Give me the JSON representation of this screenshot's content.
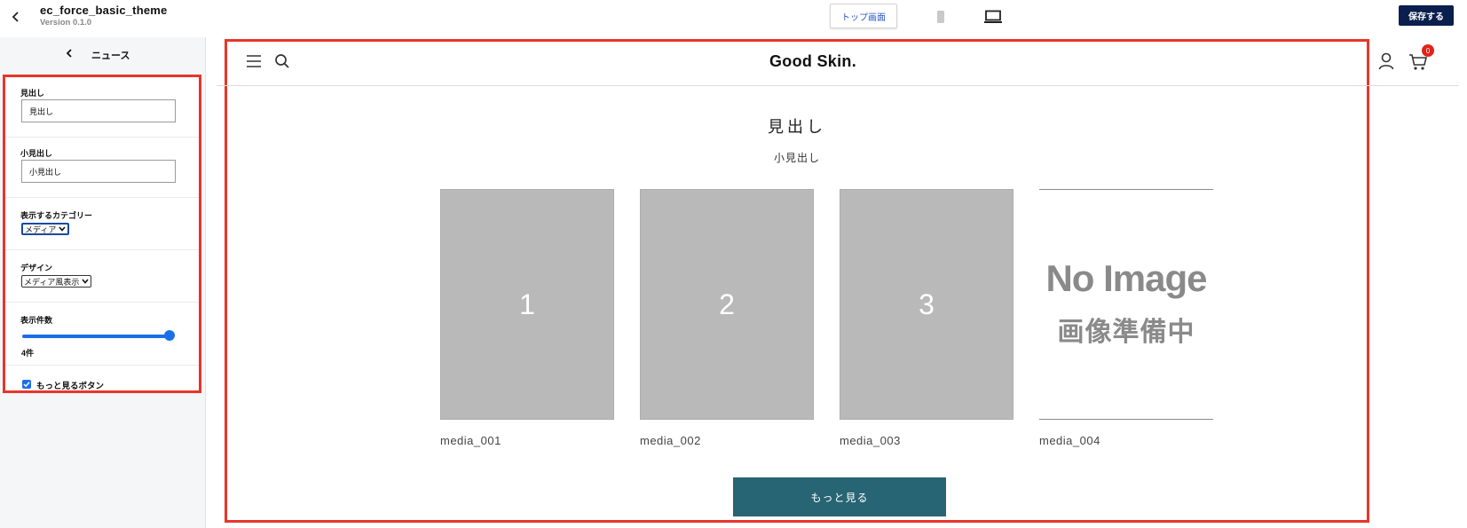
{
  "topbar": {
    "theme_name": "ec_force_basic_theme",
    "version": "Version 0.1.0",
    "top_page_label": "トップ画面",
    "save_label": "保存する"
  },
  "sidebar": {
    "title": "ニュース",
    "heading_label": "見出し",
    "heading_value": "見出し",
    "subheading_label": "小見出し",
    "subheading_value": "小見出し",
    "category_label": "表示するカテゴリー",
    "category_selected": "メディア",
    "design_label": "デザイン",
    "design_selected": "メディア風表示",
    "count_label": "表示件数",
    "count_value": "4件",
    "count_fraction": 1.0,
    "more_button_label": "もっと見るボタン",
    "more_button_checked": true
  },
  "preview": {
    "logo": "Good Skin.",
    "cart_count": "0",
    "heading": "見出し",
    "subheading": "小見出し",
    "cards": [
      {
        "image_label": "1",
        "name": "media_001"
      },
      {
        "image_label": "2",
        "name": "media_002"
      },
      {
        "image_label": "3",
        "name": "media_003"
      },
      {
        "image_label": "",
        "name": "media_004",
        "no_image_en": "No Image",
        "no_image_ja": "画像準備中"
      }
    ],
    "more_label": "もっと見る"
  },
  "colors": {
    "accent_blue": "#1a6fe8",
    "save_button": "#0a1f4e",
    "highlight_red": "#e8352a",
    "more_button": "#276474",
    "placeholder_gray": "#b9b9b9",
    "badge_red": "#e2231a"
  },
  "icons": [
    "chevron-left-icon",
    "mobile-device-icon",
    "desktop-device-icon",
    "hamburger-icon",
    "search-icon",
    "user-icon",
    "cart-icon",
    "check-icon",
    "chevron-down-icon"
  ]
}
